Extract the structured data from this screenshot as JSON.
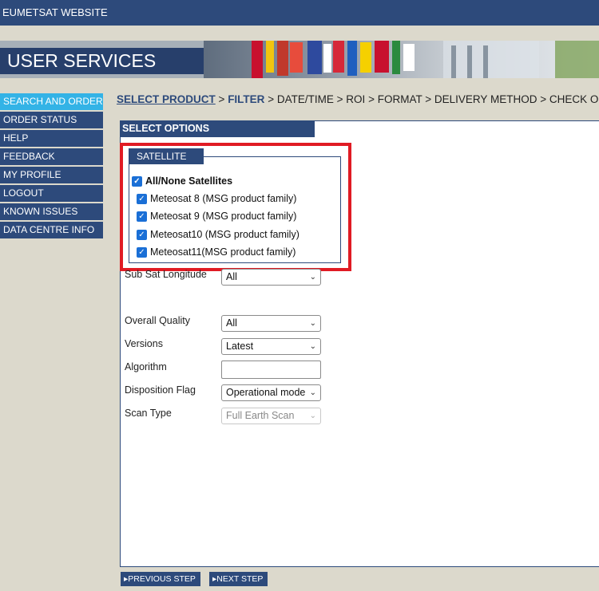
{
  "topbar": {
    "link": "EUMETSAT WEBSITE"
  },
  "banner": {
    "title": "USER SERVICES CLIENT"
  },
  "sidebar": {
    "items": [
      {
        "label": "SEARCH AND ORDER",
        "active": true
      },
      {
        "label": "ORDER STATUS"
      },
      {
        "label": "HELP"
      },
      {
        "label": "FEEDBACK"
      },
      {
        "label": "MY PROFILE"
      },
      {
        "label": "LOGOUT"
      },
      {
        "label": "KNOWN ISSUES"
      },
      {
        "label": "DATA CENTRE INFO"
      }
    ]
  },
  "breadcrumb": {
    "steps": [
      "SELECT PRODUCT",
      "FILTER",
      "DATE/TIME",
      "ROI",
      "FORMAT",
      "DELIVERY METHOD",
      "CHECK OUT"
    ],
    "separator": ">"
  },
  "panel": {
    "title": "SELECT OPTIONS"
  },
  "satellite": {
    "legend": "SATELLITE",
    "all_label": "All/None Satellites",
    "options": [
      {
        "label": "Meteosat 8 (MSG product family)",
        "checked": true
      },
      {
        "label": "Meteosat 9 (MSG product family)",
        "checked": true
      },
      {
        "label": "Meteosat10 (MSG product family)",
        "checked": true
      },
      {
        "label": "Meteosat11(MSG product family)",
        "checked": true
      }
    ]
  },
  "filters": {
    "sub_sat_longitude": {
      "label": "Sub Sat Longitude",
      "value": "All"
    },
    "overall_quality": {
      "label": "Overall Quality",
      "value": "All"
    },
    "versions": {
      "label": "Versions",
      "value": "Latest"
    },
    "algorithm": {
      "label": "Algorithm",
      "value": ""
    },
    "disposition_flag": {
      "label": "Disposition Flag",
      "value": "Operational mode"
    },
    "scan_type": {
      "label": "Scan Type",
      "value": "Full Earth Scan",
      "disabled": true
    }
  },
  "buttons": {
    "previous": "PREVIOUS STEP",
    "next": "NEXT STEP"
  },
  "colors": {
    "navy": "#2d4a7b",
    "active_nav": "#33b3e6",
    "highlight": "#e01b24",
    "checkbox": "#1a6fd6"
  },
  "icons": {
    "checkbox": "checkbox-checked-icon",
    "dropdown": "chevron-down-icon",
    "button_arrow": "triangle-right-icon"
  }
}
